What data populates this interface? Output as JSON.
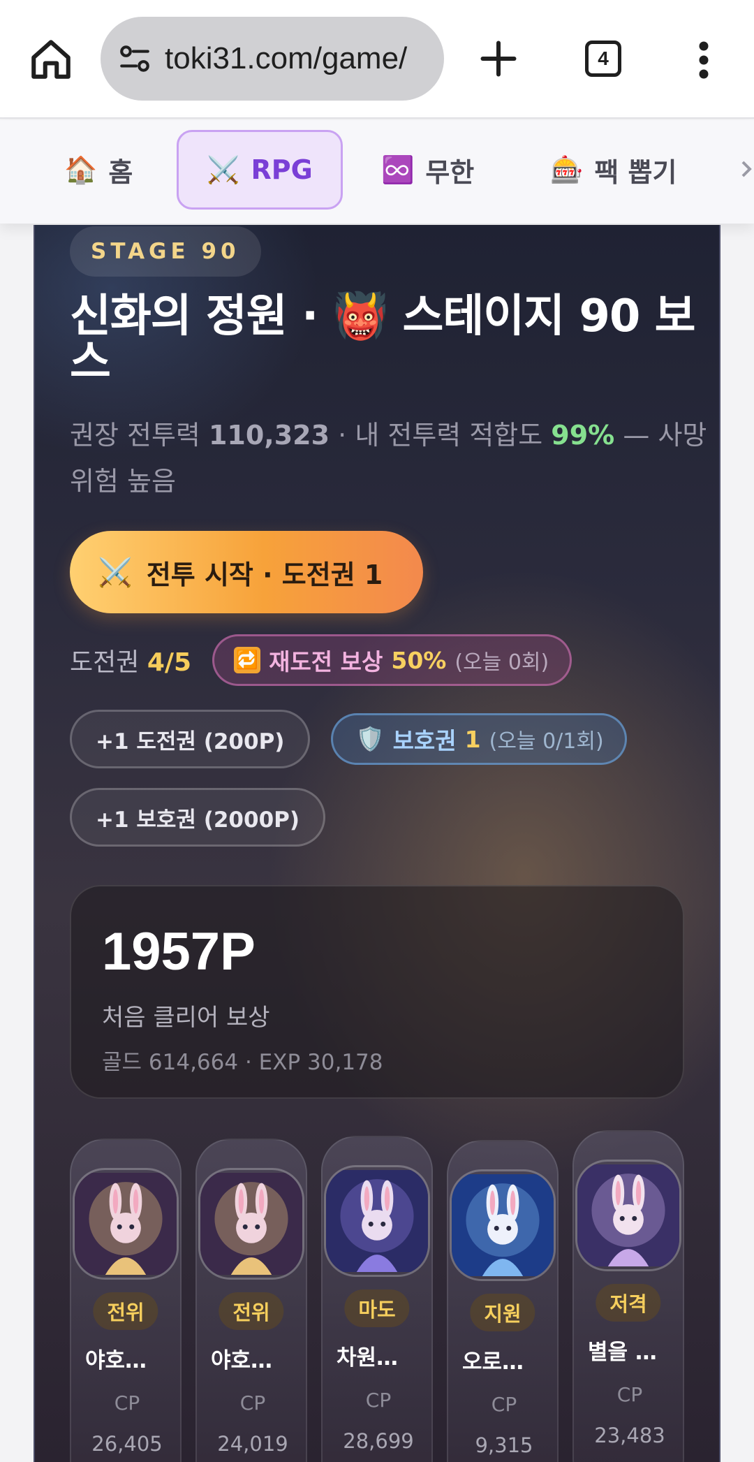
{
  "browser": {
    "url": "toki31.com/game/",
    "tab_count": "4"
  },
  "nav": {
    "items": [
      {
        "emoji": "🏠",
        "label": "홈"
      },
      {
        "emoji": "⚔️",
        "label": "RPG"
      },
      {
        "emoji": "♾️",
        "label": "무한"
      },
      {
        "emoji": "🎰",
        "label": "팩 뽑기"
      }
    ],
    "active_index": 1
  },
  "stage": {
    "badge": "STAGE 90",
    "title": "신화의 정원 · 👹 스테이지 90 보스",
    "recommended_label": "권장 전투력",
    "recommended_value": "110,323",
    "fit_label": "· 내 전투력 적합도",
    "fit_value": "99%",
    "risk_text": "— 사망 위험 높음",
    "start_button": {
      "emoji": "⚔️",
      "label": "전투 시작 · 도전권 1"
    },
    "tickets_label": "도전권",
    "tickets_value": "4/5",
    "retry": {
      "icon": "🔁",
      "label": "재도전 보상",
      "percent": "50%",
      "today": "(오늘 0회)"
    },
    "buy_ticket_label": "+1 도전권 (200P)",
    "shield": {
      "icon": "🛡️",
      "label": "보호권",
      "count": "1",
      "today": "(오늘 0/1회)"
    },
    "buy_shield_label": "+1 보호권 (2000P)"
  },
  "reward": {
    "points": "1957P",
    "label": "처음 클리어 보상",
    "detail": "골드 614,664 · EXP 30,178"
  },
  "heroes": [
    {
      "role": "전위",
      "name": "야호…",
      "cp_label": "CP",
      "cp": "26,405",
      "palette": [
        "#3b2a4a",
        "#e9c27a",
        "#f0d3dd"
      ]
    },
    {
      "role": "전위",
      "name": "야호…",
      "cp_label": "CP",
      "cp": "24,019",
      "palette": [
        "#3b2a4a",
        "#e9c27a",
        "#f0d3dd"
      ]
    },
    {
      "role": "마도",
      "name": "차원…",
      "cp_label": "CP",
      "cp": "28,699",
      "palette": [
        "#2b2c66",
        "#8a7be0",
        "#eadcf0"
      ]
    },
    {
      "role": "지원",
      "name": "오로…",
      "cp_label": "CP",
      "cp": "9,315",
      "palette": [
        "#1d3c88",
        "#7fb6f0",
        "#eef1fb"
      ]
    },
    {
      "role": "저격",
      "name": "별을 …",
      "cp_label": "CP",
      "cp": "23,483",
      "palette": [
        "#3a3066",
        "#c7a8e8",
        "#f2e2ee"
      ]
    }
  ]
}
